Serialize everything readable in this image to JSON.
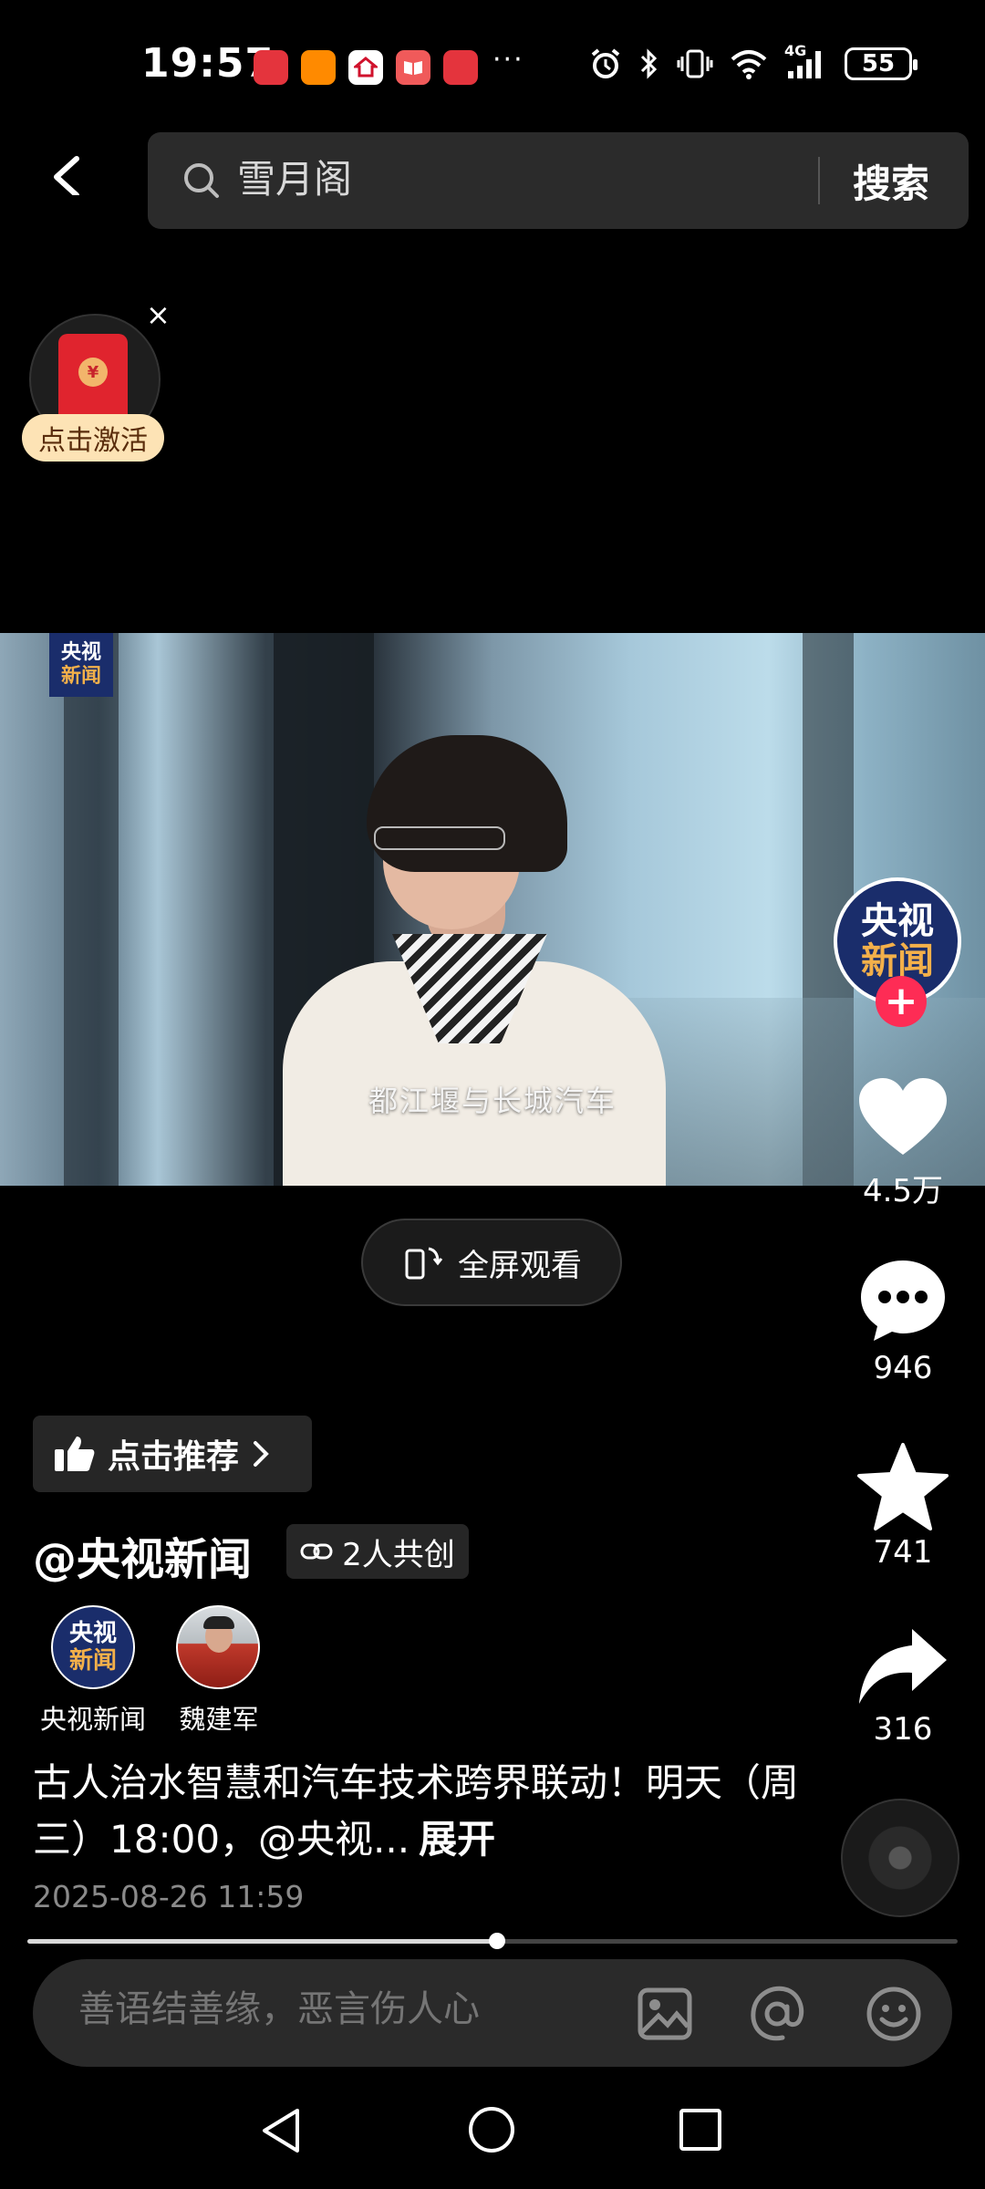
{
  "status_bar": {
    "time": "19:57",
    "battery": "55",
    "network": "4G",
    "overflow_dots": "···"
  },
  "search": {
    "query": "雪月阁",
    "button_label": "搜索"
  },
  "red_packet": {
    "coin_symbol": "¥",
    "close_symbol": "×",
    "label": "点击激活"
  },
  "video": {
    "channel_logo_line1": "央视",
    "channel_logo_line2": "新闻",
    "subtitle": "都江堰与长城汽车",
    "fullscreen_label": "全屏观看"
  },
  "right_rail": {
    "avatar_line1": "央视",
    "avatar_line2": "新闻",
    "follow_symbol": "+",
    "likes": "4.5万",
    "comments": "946",
    "favorites": "741",
    "shares": "316"
  },
  "post": {
    "recommend_label": "点击推荐",
    "author": "@央视新闻",
    "cocreate_label": "2人共创",
    "creators": [
      {
        "name": "央视新闻",
        "logo_line1": "央视",
        "logo_line2": "新闻"
      },
      {
        "name": "魏建军"
      }
    ],
    "description": "古人治水智慧和汽车技术跨界联动！明天（周三）18:00，@央视...",
    "expand_label": "展开",
    "date": "2025-08-26 11:59",
    "progress_fraction": 0.505
  },
  "comment": {
    "placeholder": "善语结善缘，恶言伤人心"
  },
  "colors": {
    "accent_red": "#fe2c55",
    "cctv_blue": "#1a2d6b",
    "red_packet": "#e0242e",
    "red_packet_pill": "#fde3b5"
  }
}
